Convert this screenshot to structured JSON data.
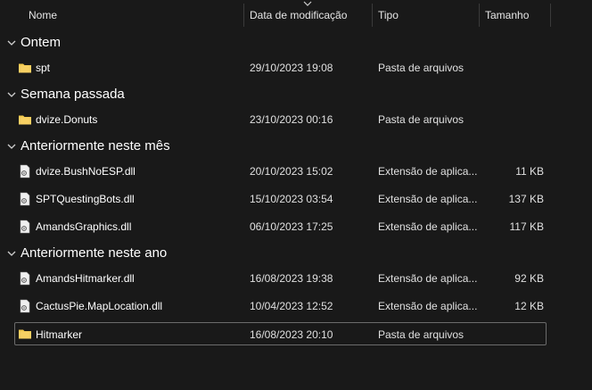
{
  "columns": {
    "name": "Nome",
    "date": "Data de modificação",
    "type": "Tipo",
    "size": "Tamanho"
  },
  "groups": [
    {
      "title": "Ontem",
      "items": [
        {
          "name": "spt",
          "date": "29/10/2023 19:08",
          "type": "Pasta de arquivos",
          "size": "",
          "icon": "folder-icon"
        }
      ]
    },
    {
      "title": "Semana passada",
      "items": [
        {
          "name": "dvize.Donuts",
          "date": "23/10/2023 00:16",
          "type": "Pasta de arquivos",
          "size": "",
          "icon": "folder-icon"
        }
      ]
    },
    {
      "title": "Anteriormente neste mês",
      "items": [
        {
          "name": "dvize.BushNoESP.dll",
          "date": "20/10/2023 15:02",
          "type": "Extensão de aplica...",
          "size": "11 KB",
          "icon": "dll-file-icon"
        },
        {
          "name": "SPTQuestingBots.dll",
          "date": "15/10/2023 03:54",
          "type": "Extensão de aplica...",
          "size": "137 KB",
          "icon": "dll-file-icon"
        },
        {
          "name": "AmandsGraphics.dll",
          "date": "06/10/2023 17:25",
          "type": "Extensão de aplica...",
          "size": "117 KB",
          "icon": "dll-file-icon"
        }
      ]
    },
    {
      "title": "Anteriormente neste ano",
      "items": [
        {
          "name": "AmandsHitmarker.dll",
          "date": "16/08/2023 19:38",
          "type": "Extensão de aplica...",
          "size": "92 KB",
          "icon": "dll-file-icon"
        },
        {
          "name": "CactusPie.MapLocation.dll",
          "date": "10/04/2023 12:52",
          "type": "Extensão de aplica...",
          "size": "12 KB",
          "icon": "dll-file-icon"
        },
        {
          "name": "Hitmarker",
          "date": "16/08/2023 20:10",
          "type": "Pasta de arquivos",
          "size": "",
          "icon": "folder-icon",
          "selected": true
        }
      ]
    }
  ],
  "colors": {
    "background": "#191919",
    "folder": "#f2c94c",
    "selection_border": "#6b6b6b"
  }
}
